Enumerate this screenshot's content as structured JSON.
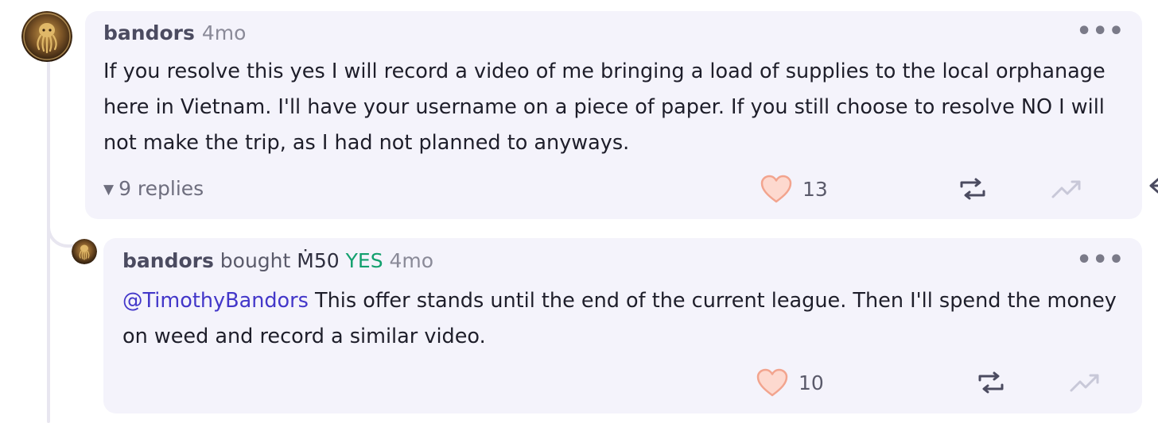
{
  "comment": {
    "username": "bandors",
    "time": "4mo",
    "more_label": "•••",
    "body": "If you resolve this yes I will record a video of me bringing a load of supplies to the local orphanage here in Vietnam. I'll have your username on a piece of paper. If you still choose to resolve NO I will not make the trip, as I had not planned to anyways.",
    "replies_label": "9 replies",
    "likes": "13"
  },
  "reply": {
    "username": "bandors",
    "verb": "bought",
    "amount": "Ṁ50",
    "outcome": "YES",
    "time": "4mo",
    "more_label": "•••",
    "mention": "@TimothyBandors",
    "body": " This offer stands until the end of the current league. Then I'll spend the money on weed and record a similar video.",
    "likes": "10"
  },
  "icons": {
    "like": "heart-icon",
    "repost": "repost-icon",
    "boost": "trending-up-icon",
    "reply": "reply-arrow-icon",
    "toggle": "triangle-down-icon"
  },
  "colors": {
    "bubble": "#f4f3fb",
    "mention": "#4337c9",
    "yes": "#13a06e",
    "heart_fill": "#fdd9cf",
    "heart_stroke": "#f2a48e"
  }
}
